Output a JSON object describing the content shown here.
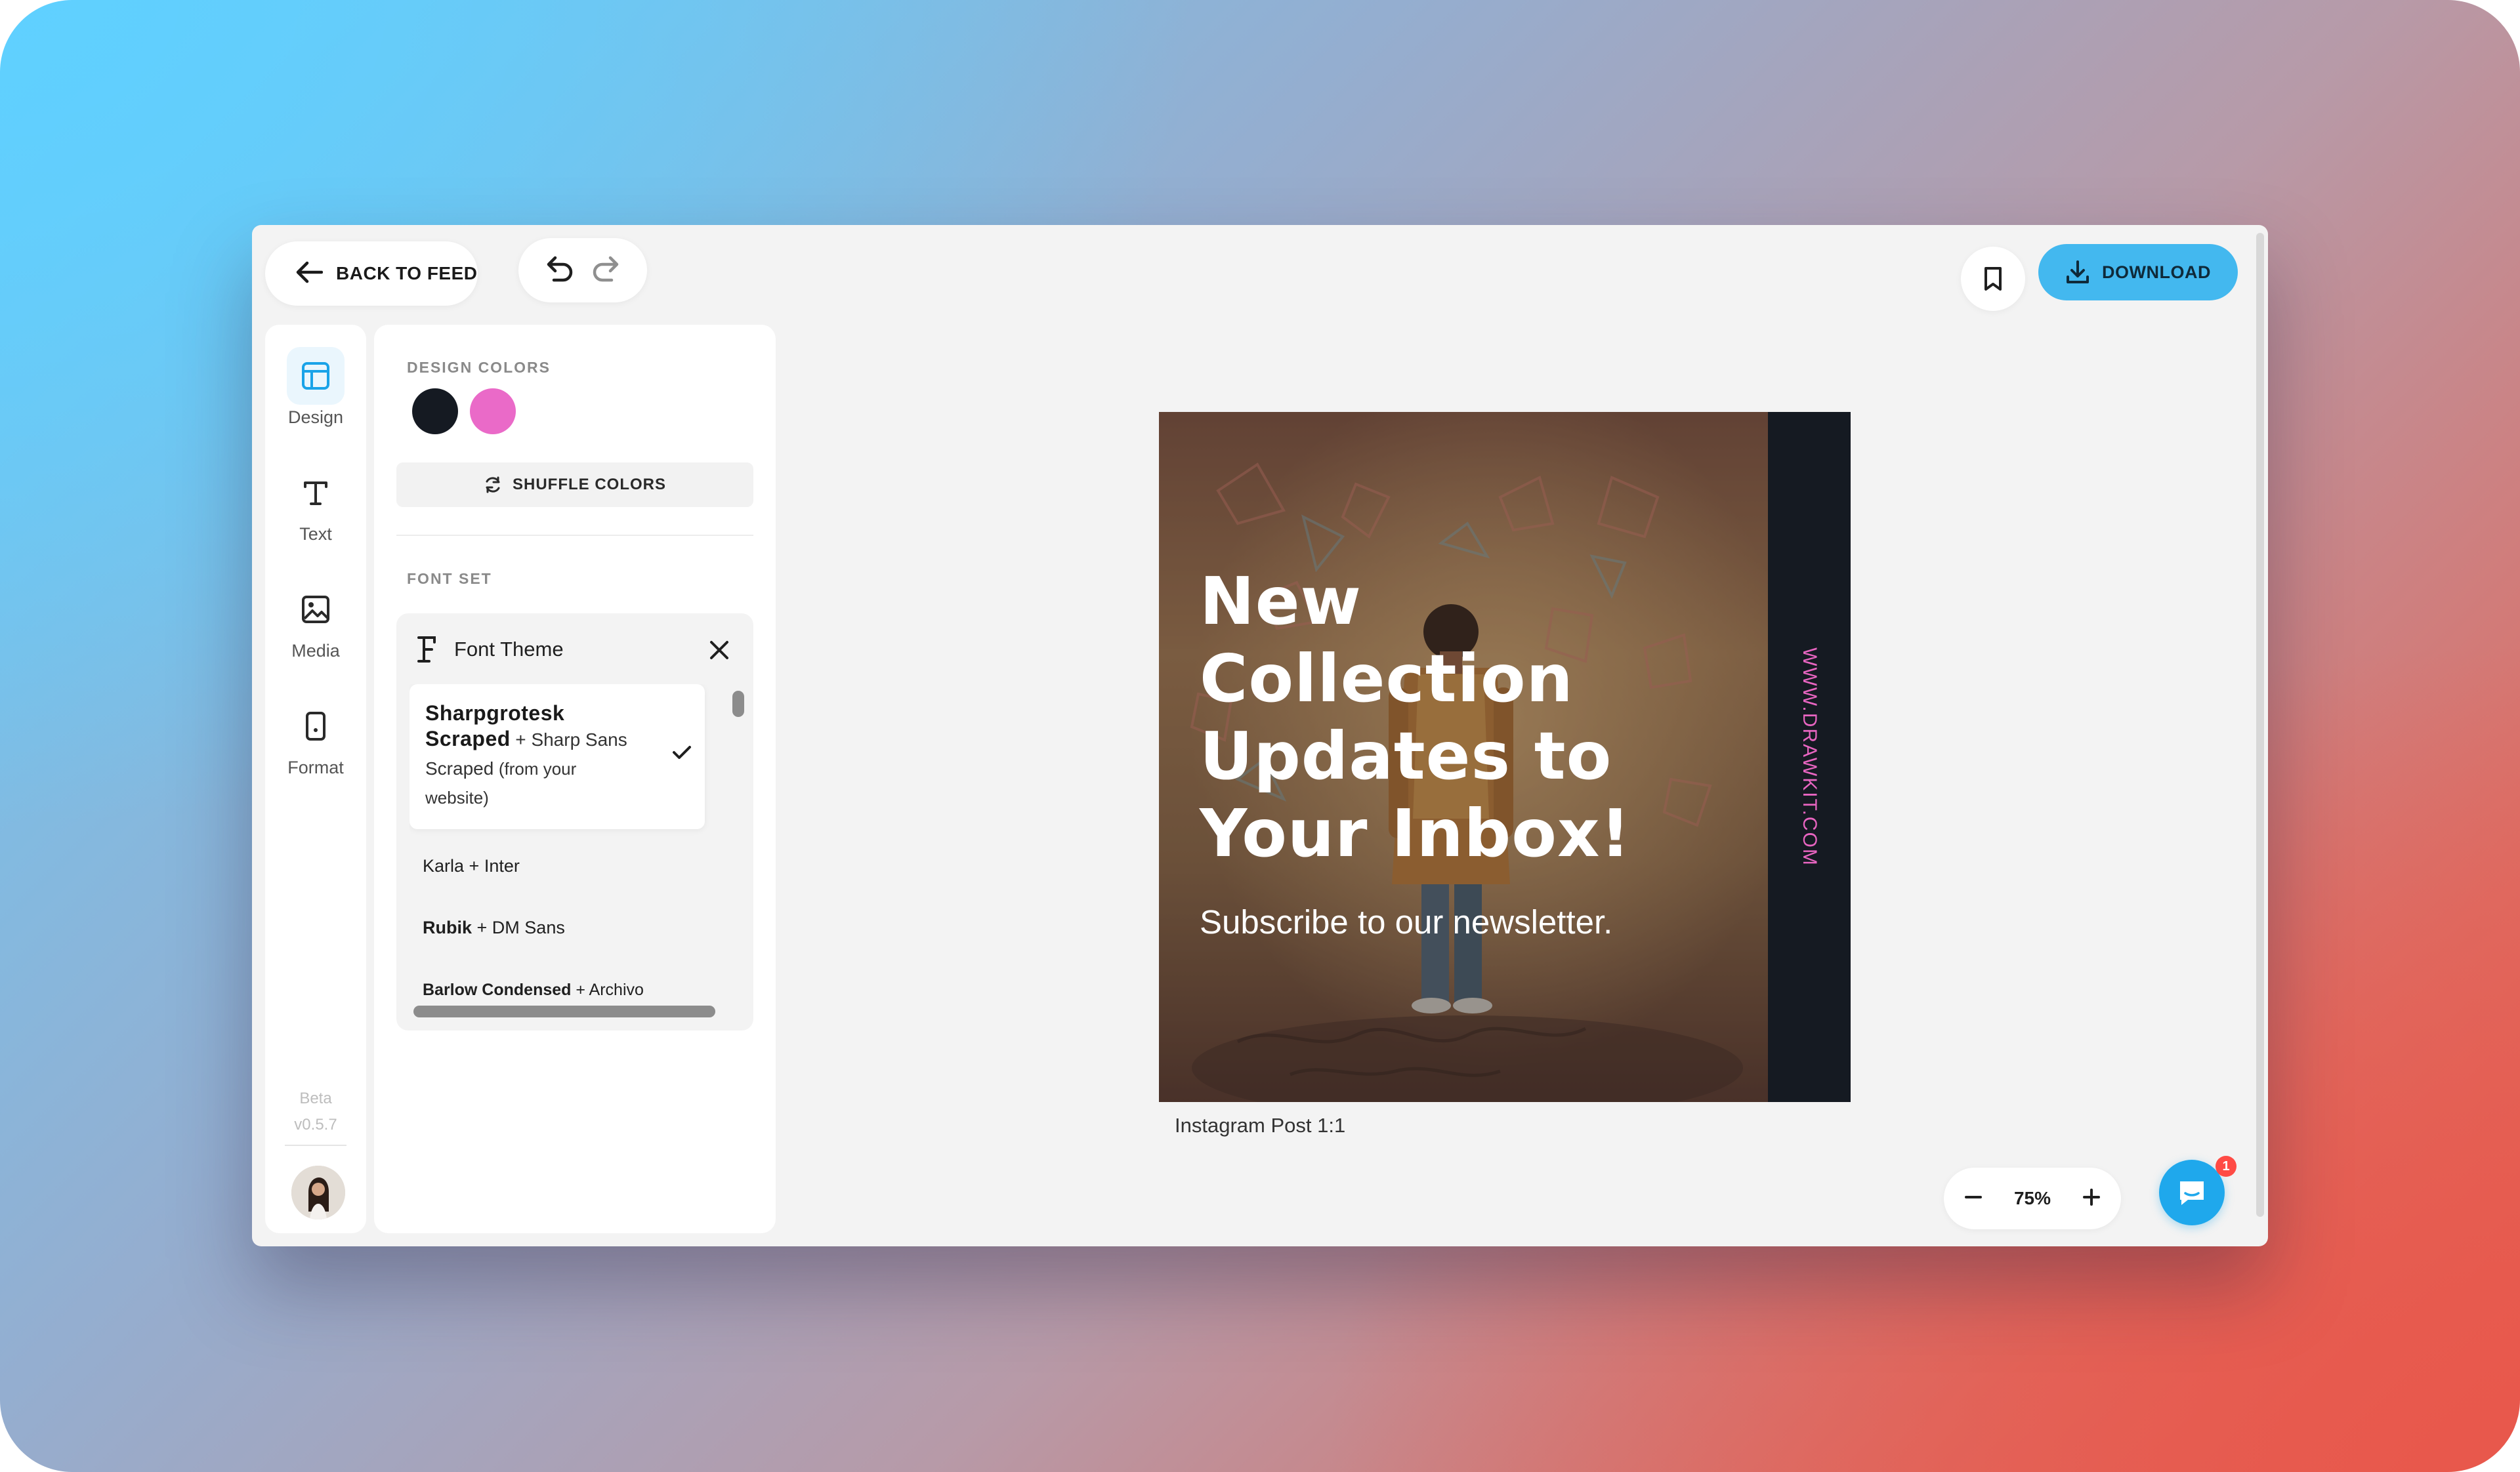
{
  "toolbar": {
    "back_label": "BACK TO FEED",
    "download_label": "DOWNLOAD"
  },
  "rail": {
    "items": [
      {
        "label": "Design",
        "icon": "layout-icon",
        "active": true
      },
      {
        "label": "Text",
        "icon": "text-icon",
        "active": false
      },
      {
        "label": "Media",
        "icon": "image-icon",
        "active": false
      },
      {
        "label": "Format",
        "icon": "device-icon",
        "active": false
      }
    ],
    "beta": "Beta",
    "version": "v0.5.7"
  },
  "panel": {
    "design_colors_label": "DESIGN COLORS",
    "colors": [
      "#151a22",
      "#ea6ac8"
    ],
    "shuffle_label": "SHUFFLE COLORS",
    "font_set_label": "FONT SET",
    "font_theme_title": "Font Theme",
    "font_options": [
      {
        "primary": "Sharpgrotesk Scraped",
        "secondary": "Sharp Sans Scraped",
        "note": "(from your website)",
        "selected": true
      },
      {
        "primary": "Karla",
        "secondary": "Inter",
        "selected": false
      },
      {
        "primary": "Rubik",
        "secondary": "DM Sans",
        "selected": false
      },
      {
        "primary": "Barlow Condensed",
        "secondary": "Archivo",
        "selected": false
      }
    ]
  },
  "canvas": {
    "post_title": "New Collection Updates to Your Inbox!",
    "post_subtitle": "Subscribe to our newsletter.",
    "post_url": "WWW.DRAWKIT.COM",
    "caption": "Instagram Post 1:1"
  },
  "zoom": {
    "value": "75%"
  },
  "chat": {
    "badge_count": "1"
  },
  "colors": {
    "accent": "#43b8ef",
    "chat": "#1fa8ec",
    "badge": "#ff4b45"
  }
}
